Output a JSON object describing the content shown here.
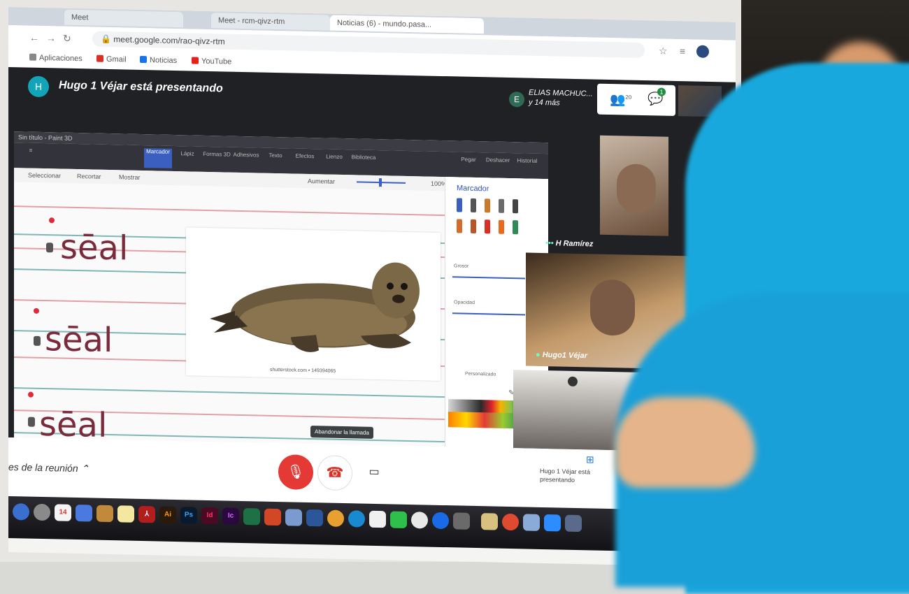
{
  "browser": {
    "tabs": [
      "Meet",
      "Meet - rcm-qivz-rtm",
      "Noticias (6) - mundo.pasa..."
    ],
    "url": "meet.google.com/rao-qivz-rtm",
    "bookmarks": [
      "Aplicaciones",
      "Gmail",
      "Noticias",
      "YouTube"
    ]
  },
  "meet": {
    "presenter_initial": "H",
    "presenter_status": "Hugo 1 Véjar está presentando",
    "participants_preview": {
      "initial": "E",
      "name": "ELIAS MACHUC...",
      "more": "y 14 más"
    },
    "people_count": "20",
    "chat_badge": "1"
  },
  "shared_app": {
    "title": "Sin título - Paint 3D",
    "ribbon": [
      "Marcador",
      "Lápiz",
      "Formas 3D",
      "Adhesivos",
      "Texto",
      "Efectos",
      "Lienzo",
      "Biblioteca",
      "Pegar",
      "Deshacer",
      "Historial"
    ],
    "subbar": [
      "Seleccionar",
      "Recortar",
      "Mostrar",
      "Aumentar",
      "100%"
    ],
    "words": [
      "sēal",
      "sēal",
      "sēal"
    ],
    "image_credit": "shutterstock.com • 149394065",
    "tooltip": "Abandonar la llamada",
    "pen_panel": {
      "title": "Marcador",
      "thickness_label": "Grosor",
      "opacity_label": "Opacidad",
      "custom_label": "Personalizado"
    }
  },
  "participants": [
    {
      "name": "H Ramírez"
    },
    {
      "name": "Hugo1 Véjar"
    },
    {
      "name": ""
    }
  ],
  "bottom_bar": {
    "details": "es de la reunión",
    "present_text": "Hugo 1 Véjar está presentando"
  },
  "dock_icons": [
    "Ai",
    "Ps",
    "Id",
    "Ic"
  ],
  "colors": {
    "meet_bg": "#202124",
    "mic_red": "#e53935",
    "accent_blue": "#3a5fc0",
    "shirt": "#18a8dd"
  }
}
